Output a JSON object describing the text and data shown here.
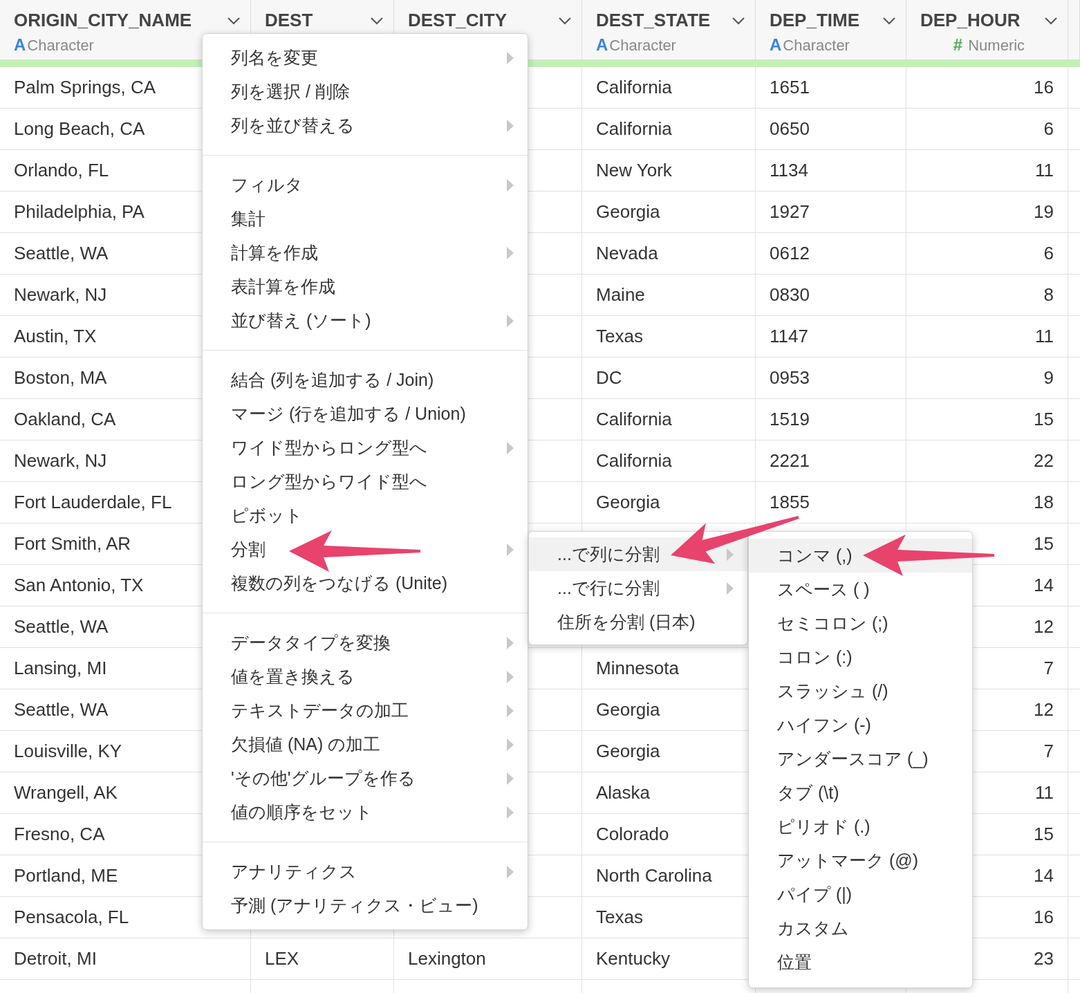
{
  "table": {
    "columns": [
      {
        "name": "ORIGIN_CITY_NAME",
        "kind": "character",
        "type_icon": "A",
        "type_label": "Character"
      },
      {
        "name": "DEST"
      },
      {
        "name": "DEST_CITY"
      },
      {
        "name": "DEST_STATE",
        "kind": "character",
        "type_icon": "A",
        "type_label": "Character"
      },
      {
        "name": "DEP_TIME",
        "kind": "character",
        "type_icon": "A",
        "type_label": "Character"
      },
      {
        "name": "DEP_HOUR",
        "kind": "numeric",
        "type_icon": "#",
        "type_label": "Numeric"
      }
    ],
    "rows": [
      [
        "Palm Springs, CA",
        null,
        null,
        "California",
        "1651",
        "16"
      ],
      [
        "Long Beach, CA",
        null,
        null,
        "California",
        "0650",
        "6"
      ],
      [
        "Orlando, FL",
        null,
        null,
        "New York",
        "1134",
        "11"
      ],
      [
        "Philadelphia, PA",
        null,
        null,
        "Georgia",
        "1927",
        "19"
      ],
      [
        "Seattle, WA",
        null,
        null,
        "Nevada",
        "0612",
        "6"
      ],
      [
        "Newark, NJ",
        null,
        null,
        "Maine",
        "0830",
        "8"
      ],
      [
        "Austin, TX",
        null,
        null,
        "Texas",
        "1147",
        "11"
      ],
      [
        "Boston, MA",
        null,
        null,
        "DC",
        "0953",
        "9"
      ],
      [
        "Oakland, CA",
        null,
        null,
        "California",
        "1519",
        "15"
      ],
      [
        "Newark, NJ",
        null,
        null,
        "California",
        "2221",
        "22"
      ],
      [
        "Fort Lauderdale, FL",
        null,
        null,
        "Georgia",
        "1855",
        "18"
      ],
      [
        "Fort Smith, AR",
        null,
        null,
        null,
        null,
        "15"
      ],
      [
        "San Antonio, TX",
        null,
        null,
        null,
        null,
        "14"
      ],
      [
        "Seattle, WA",
        null,
        null,
        null,
        null,
        "12"
      ],
      [
        "Lansing, MI",
        null,
        null,
        "Minnesota",
        null,
        "7"
      ],
      [
        "Seattle, WA",
        null,
        null,
        "Georgia",
        null,
        "12"
      ],
      [
        "Louisville, KY",
        null,
        null,
        "Georgia",
        null,
        "7"
      ],
      [
        "Wrangell, AK",
        null,
        null,
        "Alaska",
        null,
        "11"
      ],
      [
        "Fresno, CA",
        null,
        null,
        "Colorado",
        null,
        "15"
      ],
      [
        "Portland, ME",
        null,
        null,
        "North Carolina",
        null,
        "14"
      ],
      [
        "Pensacola, FL",
        null,
        null,
        "Texas",
        null,
        "16"
      ],
      [
        "Detroit, MI",
        "LEX",
        "Lexington",
        "Kentucky",
        null,
        "23"
      ]
    ]
  },
  "column_menu": {
    "groups": [
      [
        {
          "label": "列名を変更",
          "submenu": true,
          "selected": false
        },
        {
          "label": "列を選択 / 削除",
          "submenu": false,
          "selected": false
        },
        {
          "label": "列を並び替える",
          "submenu": true,
          "selected": false
        }
      ],
      [
        {
          "label": "フィルタ",
          "submenu": true,
          "selected": false
        },
        {
          "label": "集計",
          "submenu": false,
          "selected": false
        },
        {
          "label": "計算を作成",
          "submenu": true,
          "selected": false
        },
        {
          "label": "表計算を作成",
          "submenu": false,
          "selected": false
        },
        {
          "label": "並び替え (ソート)",
          "submenu": true,
          "selected": false
        }
      ],
      [
        {
          "label": "結合 (列を追加する / Join)",
          "submenu": false,
          "selected": false
        },
        {
          "label": "マージ (行を追加する / Union)",
          "submenu": false,
          "selected": false
        },
        {
          "label": "ワイド型からロング型へ",
          "submenu": true,
          "selected": false
        },
        {
          "label": "ロング型からワイド型へ",
          "submenu": false,
          "selected": false
        },
        {
          "label": "ピボット",
          "submenu": false,
          "selected": false
        },
        {
          "label": "分割",
          "submenu": true,
          "selected": false
        },
        {
          "label": "複数の列をつなげる (Unite)",
          "submenu": false,
          "selected": false
        }
      ],
      [
        {
          "label": "データタイプを変換",
          "submenu": true,
          "selected": false
        },
        {
          "label": "値を置き換える",
          "submenu": true,
          "selected": false
        },
        {
          "label": "テキストデータの加工",
          "submenu": true,
          "selected": false
        },
        {
          "label": "欠損値 (NA) の加工",
          "submenu": true,
          "selected": false
        },
        {
          "label": "'その他'グループを作る",
          "submenu": true,
          "selected": false
        },
        {
          "label": "値の順序をセット",
          "submenu": true,
          "selected": false
        }
      ],
      [
        {
          "label": "アナリティクス",
          "submenu": true,
          "selected": false
        },
        {
          "label": "予測 (アナリティクス・ビュー)",
          "submenu": false,
          "selected": false
        }
      ]
    ]
  },
  "split_submenu": {
    "items": [
      {
        "label": "...で列に分割",
        "submenu": true,
        "selected": true
      },
      {
        "label": "...で行に分割",
        "submenu": true,
        "selected": false
      },
      {
        "label": "住所を分割 (日本)",
        "submenu": false,
        "selected": false
      }
    ]
  },
  "separator_submenu": {
    "items": [
      {
        "label": "コンマ (,)",
        "selected": true
      },
      {
        "label": "スペース ( )",
        "selected": false
      },
      {
        "label": "セミコロン (;)",
        "selected": false
      },
      {
        "label": "コロン (:)",
        "selected": false
      },
      {
        "label": "スラッシュ (/)",
        "selected": false
      },
      {
        "label": "ハイフン (-)",
        "selected": false
      },
      {
        "label": "アンダースコア (_)",
        "selected": false
      },
      {
        "label": "タブ (\\t)",
        "selected": false
      },
      {
        "label": "ピリオド (.)",
        "selected": false
      },
      {
        "label": "アットマーク (@)",
        "selected": false
      },
      {
        "label": "パイプ (|)",
        "selected": false
      },
      {
        "label": "カスタム",
        "selected": false
      },
      {
        "label": "位置",
        "selected": false
      }
    ]
  }
}
